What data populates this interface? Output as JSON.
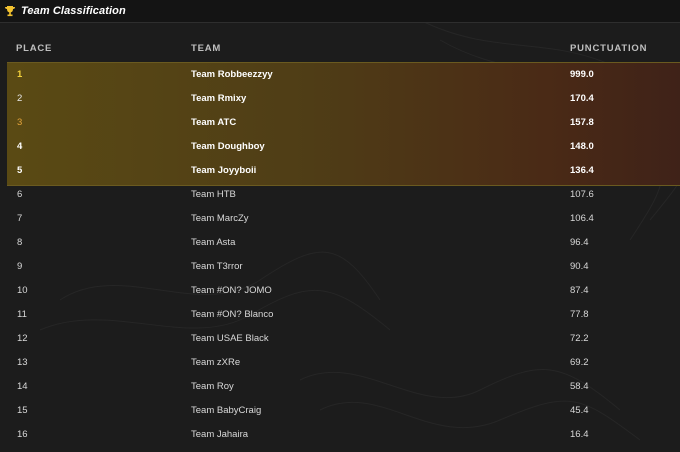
{
  "header": {
    "title": "Team Classification",
    "icon": "trophy-icon"
  },
  "columns": {
    "place": "PLACE",
    "team": "TEAM",
    "score": "PUNCTUATION"
  },
  "rows": [
    {
      "place": "1",
      "team": "Team Robbeezzyy",
      "score": "999.0"
    },
    {
      "place": "2",
      "team": "Team Rmixy",
      "score": "170.4"
    },
    {
      "place": "3",
      "team": "Team ATC",
      "score": "157.8"
    },
    {
      "place": "4",
      "team": "Team Doughboy",
      "score": "148.0"
    },
    {
      "place": "5",
      "team": "Team Joyyboii",
      "score": "136.4"
    },
    {
      "place": "6",
      "team": "Team HTB",
      "score": "107.6"
    },
    {
      "place": "7",
      "team": "Team MarcZy",
      "score": "106.4"
    },
    {
      "place": "8",
      "team": "Team Asta",
      "score": "96.4"
    },
    {
      "place": "9",
      "team": "Team T3rror",
      "score": "90.4"
    },
    {
      "place": "10",
      "team": "Team #ON? JOMO",
      "score": "87.4"
    },
    {
      "place": "11",
      "team": "Team #ON? Blanco",
      "score": "77.8"
    },
    {
      "place": "12",
      "team": "Team USAE Black",
      "score": "72.2"
    },
    {
      "place": "13",
      "team": "Team zXRe",
      "score": "69.2"
    },
    {
      "place": "14",
      "team": "Team Roy",
      "score": "58.4"
    },
    {
      "place": "15",
      "team": "Team BabyCraig",
      "score": "45.4"
    },
    {
      "place": "16",
      "team": "Team Jahaira",
      "score": "16.4"
    }
  ],
  "colors": {
    "gold": "#f2d13c",
    "bronze": "#e3a33a",
    "highlight": "#5a4a14"
  }
}
